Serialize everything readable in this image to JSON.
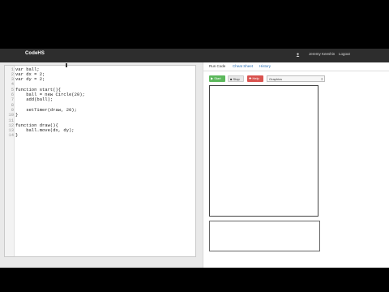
{
  "header": {
    "logo": "CodeHS",
    "user_name": "Jeremy Keeshin",
    "logout_label": "Logout"
  },
  "editor": {
    "lines": [
      {
        "num": "1",
        "text": "var ball;"
      },
      {
        "num": "2",
        "text": "var dx = 2;"
      },
      {
        "num": "3",
        "text": "var dy = 2;"
      },
      {
        "num": "4",
        "text": ""
      },
      {
        "num": "5",
        "text": "function start(){"
      },
      {
        "num": "6",
        "text": "    ball = new Circle(20);"
      },
      {
        "num": "7",
        "text": "    add(ball);"
      },
      {
        "num": "8",
        "text": ""
      },
      {
        "num": "9",
        "text": "    setTimer(draw, 20);"
      },
      {
        "num": "10",
        "text": "}"
      },
      {
        "num": "11",
        "text": ""
      },
      {
        "num": "12",
        "text": "function draw(){"
      },
      {
        "num": "13",
        "text": "    ball.move(dx, dy);"
      },
      {
        "num": "14",
        "text": "}"
      }
    ]
  },
  "panel": {
    "tabs": [
      "Run Code",
      "Cheat Sheet",
      "History"
    ],
    "start_label": "Start",
    "stop_label": "Stop",
    "help_label": "Help",
    "mode_select": "Graphics"
  },
  "colors": {
    "navbar": "#2d2d2d",
    "start": "#5cb85c",
    "help": "#d9534f",
    "link": "#2a6fb5"
  }
}
